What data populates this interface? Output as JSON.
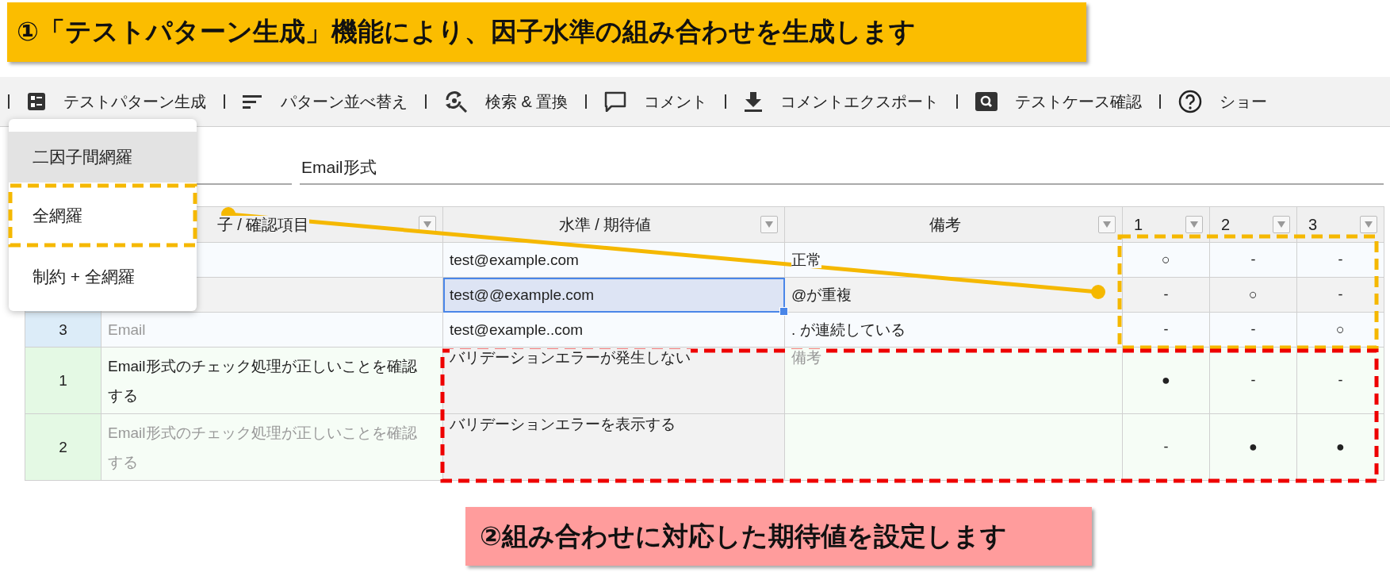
{
  "top_callout": {
    "text": "①「テストパターン生成」機能により、因子水準の組み合わせを生成します"
  },
  "toolbar": {
    "items": [
      {
        "label": "テストパターン生成"
      },
      {
        "label": "パターン並べ替え"
      },
      {
        "label": "検索 & 置換"
      },
      {
        "label": "コメント"
      },
      {
        "label": "コメントエクスポート"
      },
      {
        "label": "テストケース確認"
      },
      {
        "label": "ショー"
      }
    ]
  },
  "name_field": {
    "value": "Email形式"
  },
  "pattern_menu": {
    "items": [
      {
        "label": "二因子間網羅",
        "selected": true
      },
      {
        "label": "全網羅",
        "selected": false
      },
      {
        "label": "制約 + 全網羅",
        "selected": false
      }
    ]
  },
  "table": {
    "columns": [
      {
        "label": "子 / 確認項目"
      },
      {
        "label": "水準 / 期待値"
      },
      {
        "label": "備考"
      },
      {
        "label": "1"
      },
      {
        "label": "2"
      },
      {
        "label": "3"
      }
    ],
    "factor_rows": [
      {
        "level": "test@example.com",
        "note": "正常",
        "level_selected": false,
        "marks": [
          "○",
          "-",
          "-"
        ]
      },
      {
        "level": "test@@example.com",
        "note": "@が重複",
        "level_selected": true,
        "marks": [
          "-",
          "○",
          "-"
        ]
      },
      {
        "number": "3",
        "factor": "Email",
        "factor_dimmed": true,
        "level": "test@example..com",
        "note": ". が連続している",
        "level_selected": false,
        "marks": [
          "-",
          "-",
          "○"
        ]
      }
    ],
    "test_rows": [
      {
        "number": "1",
        "item": "Email形式のチェック処理が正しいことを確認する",
        "item_dimmed": false,
        "expected": "バリデーションエラーが発生しない",
        "note_placeholder": "備考",
        "marks": [
          "●",
          "-",
          "-"
        ]
      },
      {
        "number": "2",
        "item": "Email形式のチェック処理が正しいことを確認する",
        "item_dimmed": true,
        "expected": "バリデーションエラーを表示する",
        "marks": [
          "-",
          "●",
          "●"
        ]
      }
    ]
  },
  "bottom_callout": {
    "text": "②組み合わせに対応した期待値を設定します"
  }
}
